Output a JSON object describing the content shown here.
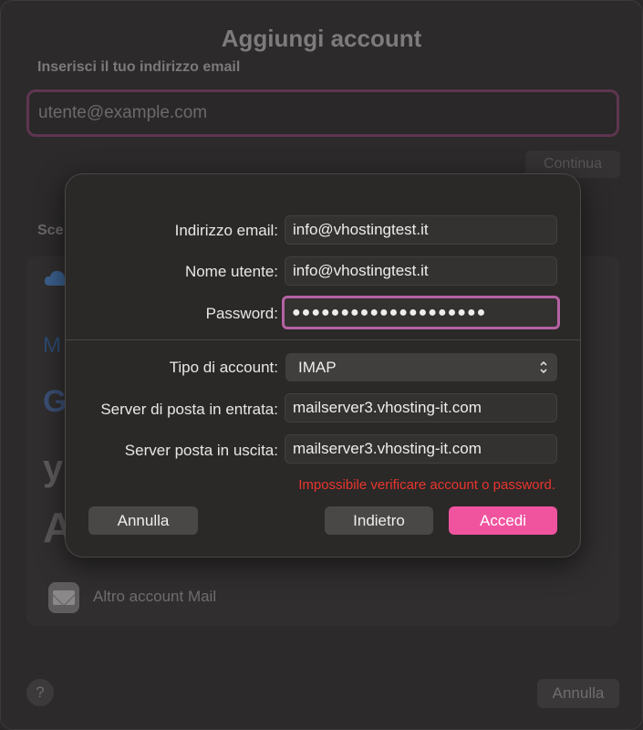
{
  "background": {
    "title": "Aggiungi account",
    "email_label": "Inserisci il tuo indirizzo email",
    "email_placeholder": "utente@example.com",
    "continue_label": "Continua",
    "choose_label": "Sce",
    "providers": [
      "M",
      "G",
      "y",
      "A"
    ],
    "other_account_label": "Altro account Mail",
    "help_label": "?",
    "cancel_label": "Annulla"
  },
  "dialog": {
    "email_label": "Indirizzo email:",
    "email_value": "info@vhostingtest.it",
    "username_label": "Nome utente:",
    "username_value": "info@vhostingtest.it",
    "password_label": "Password:",
    "password_value": "●●●●●●●●●●●●●●●●●●●●",
    "account_type_label": "Tipo di account:",
    "account_type_value": "IMAP",
    "incoming_label": "Server di posta in entrata:",
    "incoming_value": "mailserver3.vhosting-it.com",
    "outgoing_label": "Server posta in uscita:",
    "outgoing_value": "mailserver3.vhosting-it.com",
    "error_text": "Impossibile verificare account o password.",
    "cancel_button": "Annulla",
    "back_button": "Indietro",
    "login_button": "Accedi"
  },
  "colors": {
    "accent": "#f0549f",
    "focus_ring": "#b562a4",
    "error": "#e8352c"
  },
  "icons": {
    "select_chevron": "chevron-up-down-icon",
    "mail": "mail-envelope-icon",
    "icloud": "cloud-icon"
  }
}
